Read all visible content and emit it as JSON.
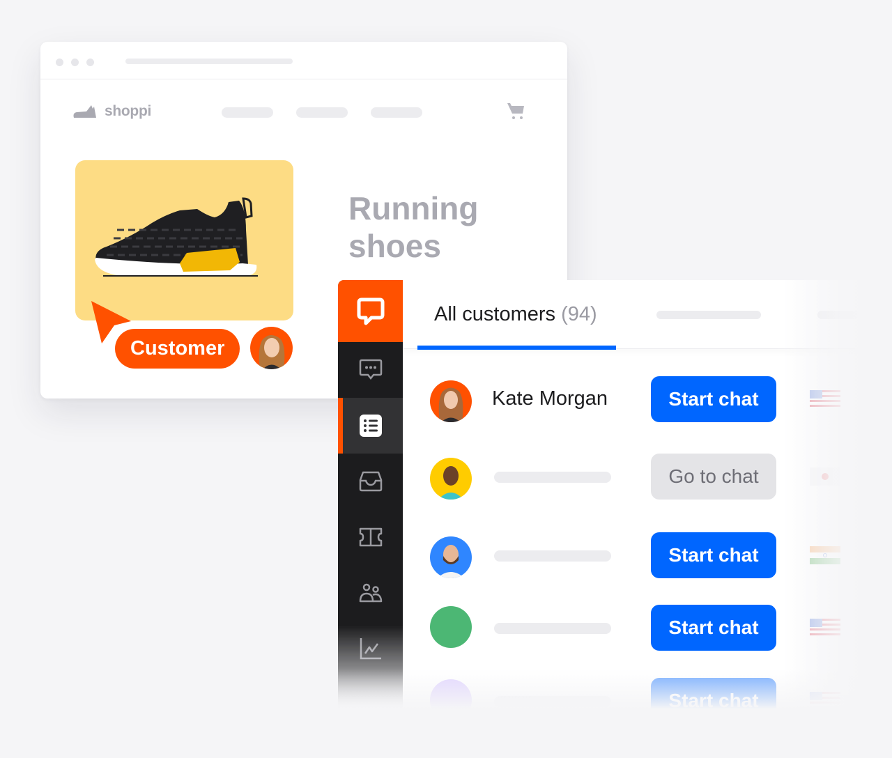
{
  "browser": {
    "window_dots": 3,
    "store": {
      "logo_text": "shoppi",
      "nav_placeholders": 3,
      "cart_icon": "shopping-cart-icon"
    },
    "product": {
      "title_line1": "Running",
      "title_line2": "shoes",
      "image": "black-yellow-running-sneaker"
    },
    "customer_tag": {
      "label": "Customer",
      "color": "#ff5100"
    }
  },
  "app": {
    "brand_color": "#ff5100",
    "accent_color": "#0066ff",
    "sidebar": {
      "logo_icon": "chat-bubble-logo-icon",
      "items": [
        {
          "icon": "chats-icon",
          "active": false
        },
        {
          "icon": "customers-list-icon",
          "active": true
        },
        {
          "icon": "inbox-icon",
          "active": false
        },
        {
          "icon": "ticket-icon",
          "active": false
        },
        {
          "icon": "team-icon",
          "active": false
        },
        {
          "icon": "reports-icon",
          "active": false
        }
      ]
    },
    "tabs": {
      "active_label": "All customers",
      "active_count": "(94)"
    },
    "customers": [
      {
        "name": "Kate Morgan",
        "avatar_bg": "#ff5100",
        "action": "Start chat",
        "flag": "US"
      },
      {
        "name": "",
        "avatar_bg": "#ffcc00",
        "action": "Go to chat",
        "flag": "JP"
      },
      {
        "name": "",
        "avatar_bg": "#2f86ff",
        "action": "Start chat",
        "flag": "IN"
      },
      {
        "name": "",
        "avatar_bg": "#4cb774",
        "action": "Start chat",
        "flag": "US"
      },
      {
        "name": "",
        "avatar_bg": "#c9b3ff",
        "action": "Start chat",
        "flag": "US"
      }
    ]
  }
}
